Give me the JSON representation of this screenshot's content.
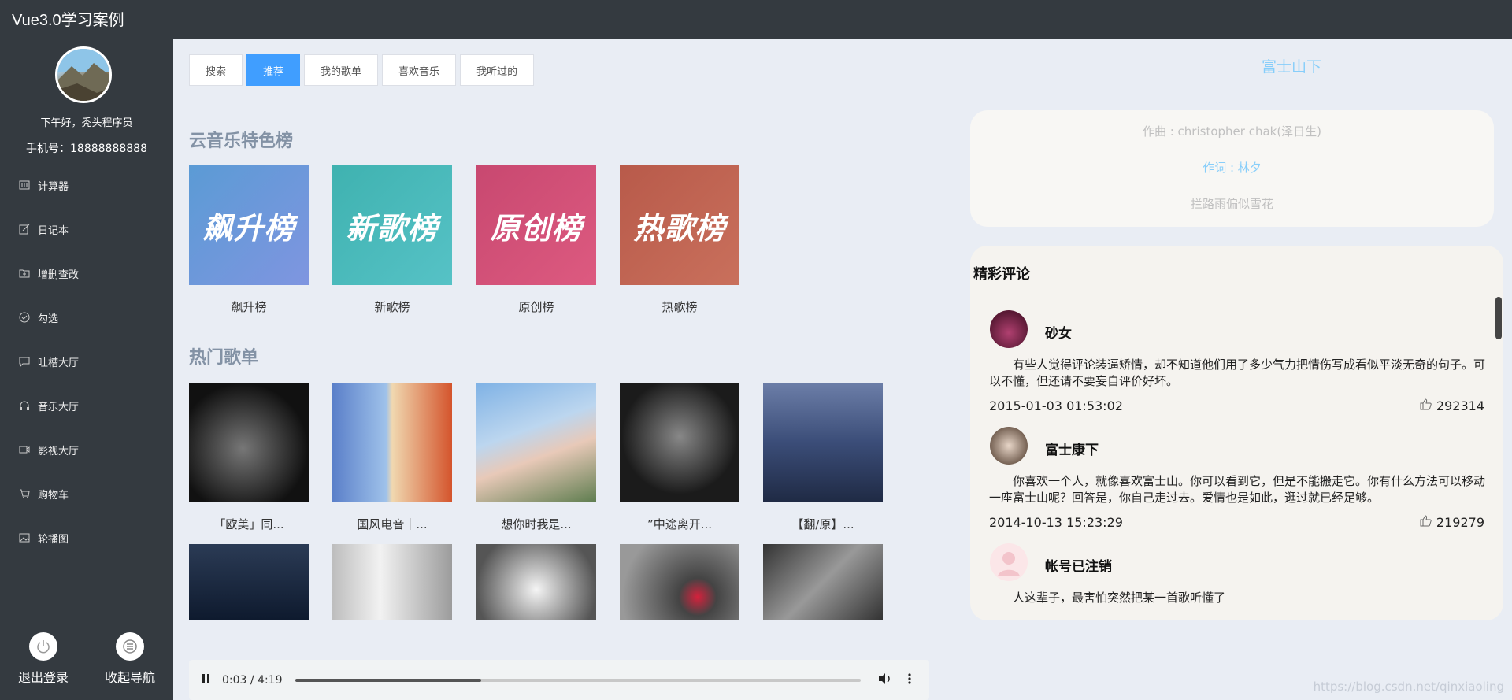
{
  "app": {
    "title": "Vue3.0学习案例"
  },
  "user": {
    "greeting": "下午好，秃头程序员",
    "phone": "手机号：18888888888"
  },
  "nav": [
    {
      "label": "计算器",
      "icon": "calculator-icon"
    },
    {
      "label": "日记本",
      "icon": "edit-icon"
    },
    {
      "label": "增删查改",
      "icon": "folder-add-icon"
    },
    {
      "label": "勾选",
      "icon": "check-circle-icon"
    },
    {
      "label": "吐槽大厅",
      "icon": "chat-icon"
    },
    {
      "label": "音乐大厅",
      "icon": "headphones-icon"
    },
    {
      "label": "影视大厅",
      "icon": "video-icon"
    },
    {
      "label": "购物车",
      "icon": "cart-icon"
    },
    {
      "label": "轮播图",
      "icon": "picture-icon"
    }
  ],
  "bottom": {
    "logout": "退出登录",
    "collapse": "收起导航"
  },
  "tabs": [
    "搜索",
    "推荐",
    "我的歌单",
    "喜欢音乐",
    "我听过的"
  ],
  "sections": {
    "ranks": "云音乐特色榜",
    "playlists": "热门歌单"
  },
  "ranks": [
    {
      "label": "飙升榜",
      "cover_text": "飙升榜",
      "color1": "#5b9bd5",
      "color2": "#7f95e0"
    },
    {
      "label": "新歌榜",
      "cover_text": "新歌榜",
      "color1": "#3fb2b0",
      "color2": "#56c2c6"
    },
    {
      "label": "原创榜",
      "cover_text": "原创榜",
      "color1": "#c84870",
      "color2": "#dd5a80"
    },
    {
      "label": "热歌榜",
      "cover_text": "热歌榜",
      "color1": "#b85a4a",
      "color2": "#c9705c"
    }
  ],
  "playlists": [
    {
      "label": "「欧美」同...",
      "color1": "#111",
      "color2": "#666"
    },
    {
      "label": "国风电音｜...",
      "color1": "#5a7fc9",
      "color2": "#d4542c"
    },
    {
      "label": "想你时我是...",
      "color1": "#9ac3e8",
      "color2": "#d9c6b8"
    },
    {
      "label": "”中途离开...",
      "color1": "#1b1b1b",
      "color2": "#6b6b6b"
    },
    {
      "label": "【翻/原】...",
      "color1": "#2e3d63",
      "color2": "#7a8cb6"
    }
  ],
  "playlists_row2": [
    {
      "color1": "#0e1a2e",
      "color2": "#3b4a66"
    },
    {
      "color1": "#e5e5e5",
      "color2": "#8a8a8a"
    },
    {
      "color1": "#f2f2f2",
      "color2": "#555555"
    },
    {
      "color1": "#222",
      "color2": "#999"
    },
    {
      "color1": "#333",
      "color2": "#888"
    }
  ],
  "player": {
    "time": "0:03 / 4:19",
    "progress": 0.33
  },
  "song": {
    "title": "富士山下",
    "composer": "作曲 : christopher chak(泽日生)",
    "lyricist": "作词 : 林夕",
    "lyric_line": "拦路雨偏似雪花"
  },
  "comments": {
    "title": "精彩评论",
    "items": [
      {
        "name": "砂女",
        "text": "有些人觉得评论装逼矫情，却不知道他们用了多少气力把情伤写成看似平淡无奇的句子。可以不懂，但还请不要妄自评价好坏。",
        "time": "2015-01-03 01:53:02",
        "likes": "292314"
      },
      {
        "name": "富士康下",
        "text": "你喜欢一个人，就像喜欢富士山。你可以看到它，但是不能搬走它。你有什么方法可以移动一座富士山呢？回答是，你自己走过去。爱情也是如此，逛过就已经足够。",
        "time": "2014-10-13 15:23:29",
        "likes": "219279"
      },
      {
        "name": "帐号已注销",
        "text": "人这辈子，最害怕突然把某一首歌听懂了"
      }
    ]
  },
  "watermark": "https://blog.csdn.net/qinxiaoling",
  "colors": {
    "accent": "#409eff",
    "sidebar": "#343a40",
    "song_title": "#87cefa"
  }
}
